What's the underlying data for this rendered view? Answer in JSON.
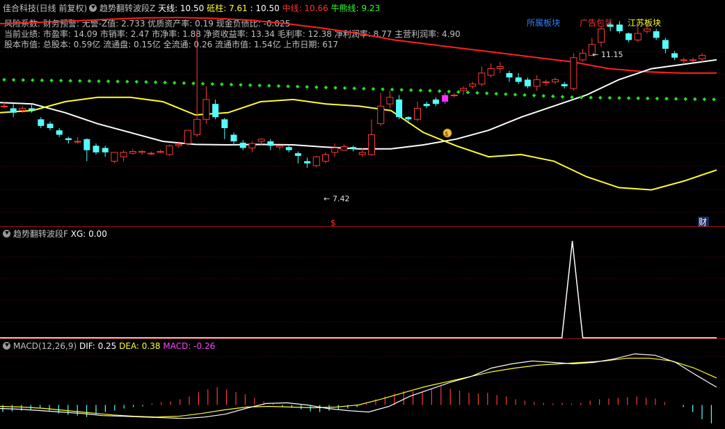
{
  "header": {
    "stock": "佳合科技(日线 前复权)",
    "ind1_name": "趋势翻转波段Z",
    "tianxian": "天线: 10.50",
    "dizhu": "砥柱: 7.61",
    "val2": ": 10.50",
    "zhongxian": "中线: 10.66",
    "niuxiong": "牛熊线: 9.23"
  },
  "info": {
    "line1": "风险系数: 财务预警: 无警-Z值: 2.733 优质资产率: 0.19 现金负债比: -0.025",
    "line2": "当前业绩: 市盈率: 14.09 市销率: 2.47 市净率: 1.88 净资收益率: 13.34 毛利率: 12.38 净利润率: 8.77 主营利润率: 4.90",
    "line3": "股本市值: 总股本: 0.59亿 流通盘: 0.15亿 全流通: 0.26 流通市值: 1.54亿 上市日期: 617"
  },
  "sectors": {
    "s1": "所属板块",
    "s2": "广告包装",
    "s3": "江苏板块"
  },
  "annotations": {
    "high": "11.15",
    "low": "7.42",
    "marker_s": "$",
    "marker_cai": "财"
  },
  "panel2": {
    "name": "趋势翻转波段F",
    "xg": "XG: 0.00"
  },
  "panel3": {
    "name": "MACD(12,26,9)",
    "dif": "DIF: 0.25",
    "dea": "DEA: 0.38",
    "macd": "MACD: -0.26"
  },
  "colors": {
    "up": "#ff3a3a",
    "down": "#54ffff",
    "midline": "#ff2020",
    "white": "#ffffff",
    "yellow": "#ffff30",
    "green_dots": "#20e020",
    "magenta": "#ff30ff"
  },
  "chart_data": [
    {
      "type": "candlestick",
      "candles": [
        [
          9.85,
          9.85,
          9.95,
          9.8
        ],
        [
          9.8,
          9.7,
          9.9,
          9.6
        ],
        [
          9.75,
          9.8,
          9.85,
          9.7
        ],
        [
          9.8,
          9.75,
          9.9,
          9.7
        ],
        [
          9.55,
          9.4,
          9.6,
          9.35
        ],
        [
          9.45,
          9.35,
          9.5,
          9.3
        ],
        [
          9.3,
          9.2,
          9.35,
          9.15
        ],
        [
          9.12,
          9.08,
          9.15,
          9.0
        ],
        [
          9.05,
          9.05,
          9.15,
          9.0
        ],
        [
          9.1,
          8.85,
          9.12,
          8.6
        ],
        [
          8.95,
          8.8,
          9.0,
          8.75
        ],
        [
          8.9,
          8.8,
          8.95,
          8.7
        ],
        [
          8.6,
          8.8,
          8.8,
          8.55
        ],
        [
          8.7,
          8.8,
          8.85,
          8.6
        ],
        [
          8.78,
          8.82,
          8.88,
          8.75
        ],
        [
          8.8,
          8.82,
          8.85,
          8.75
        ],
        [
          8.78,
          8.78,
          8.82,
          8.74
        ],
        [
          8.8,
          8.82,
          8.86,
          8.78
        ],
        [
          8.75,
          8.95,
          8.98,
          8.72
        ],
        [
          8.95,
          8.98,
          9.05,
          8.9
        ],
        [
          9.0,
          9.3,
          9.3,
          8.95
        ],
        [
          9.2,
          9.55,
          11.6,
          9.15
        ],
        [
          9.55,
          10.0,
          10.3,
          9.45
        ],
        [
          9.9,
          9.6,
          10.0,
          9.55
        ],
        [
          9.55,
          9.35,
          9.58,
          9.1
        ],
        [
          9.2,
          9.05,
          9.25,
          8.95
        ],
        [
          9.02,
          8.9,
          9.08,
          8.85
        ],
        [
          8.9,
          9.0,
          9.05,
          8.8
        ],
        [
          9.05,
          9.1,
          9.12,
          8.95
        ],
        [
          9.05,
          8.95,
          9.1,
          8.85
        ],
        [
          8.92,
          8.95,
          8.95,
          8.85
        ],
        [
          8.92,
          8.85,
          8.95,
          8.8
        ],
        [
          8.78,
          8.72,
          8.82,
          8.55
        ],
        [
          8.6,
          8.55,
          8.68,
          8.45
        ],
        [
          8.5,
          8.7,
          8.72,
          8.46
        ],
        [
          8.6,
          8.75,
          8.8,
          8.55
        ],
        [
          8.8,
          8.9,
          9.0,
          8.7
        ],
        [
          8.85,
          8.93,
          8.98,
          8.84
        ],
        [
          8.92,
          8.88,
          8.95,
          8.82
        ],
        [
          8.75,
          8.8,
          8.9,
          8.7
        ],
        [
          8.75,
          9.2,
          9.55,
          8.72
        ],
        [
          9.45,
          9.85,
          10.15,
          9.4
        ],
        [
          9.9,
          10.05,
          10.2,
          9.8
        ],
        [
          10.0,
          9.6,
          10.1,
          9.55
        ],
        [
          9.6,
          9.55,
          9.62,
          9.45
        ],
        [
          9.55,
          9.8,
          9.95,
          9.5
        ],
        [
          9.9,
          9.85,
          9.95,
          9.8
        ],
        [
          10.0,
          9.9,
          10.05,
          9.85
        ],
        [
          9.95,
          10.1,
          10.15,
          9.9
        ],
        [
          10.1,
          10.1,
          10.15,
          10.05
        ],
        [
          10.2,
          10.25,
          10.3,
          10.1
        ],
        [
          10.3,
          10.35,
          10.4,
          10.25
        ],
        [
          10.35,
          10.6,
          10.75,
          10.3
        ],
        [
          10.55,
          10.7,
          10.82,
          10.5
        ],
        [
          10.7,
          10.75,
          10.85,
          10.6
        ],
        [
          10.6,
          10.5,
          10.65,
          10.4
        ],
        [
          10.5,
          10.4,
          10.6,
          10.35
        ],
        [
          10.45,
          10.3,
          10.5,
          10.25
        ],
        [
          10.3,
          10.45,
          10.55,
          10.2
        ],
        [
          10.4,
          10.4,
          10.45,
          10.3
        ],
        [
          10.4,
          10.45,
          10.5,
          10.35
        ],
        [
          10.35,
          10.3,
          10.4,
          10.25
        ],
        [
          10.25,
          10.95,
          11.05,
          10.2
        ],
        [
          10.9,
          11.05,
          11.15,
          10.85
        ],
        [
          11.0,
          11.25,
          11.4,
          11.0
        ],
        [
          11.3,
          11.6,
          11.65,
          11.2
        ],
        [
          11.7,
          11.65,
          11.75,
          11.55
        ],
        [
          11.7,
          11.55,
          11.78,
          11.5
        ],
        [
          11.5,
          11.35,
          11.52,
          11.3
        ],
        [
          11.35,
          11.5,
          11.65,
          11.3
        ],
        [
          11.55,
          11.6,
          11.7,
          11.5
        ],
        [
          11.55,
          11.4,
          11.6,
          11.35
        ],
        [
          11.35,
          11.15,
          11.4,
          11.05
        ],
        [
          11.05,
          10.95,
          11.1,
          10.9
        ],
        [
          10.9,
          10.9,
          10.95,
          10.8
        ],
        [
          10.9,
          10.9,
          10.95,
          10.85
        ],
        [
          10.92,
          11.0,
          11.05,
          10.85
        ]
      ],
      "midline_red": [
        11.72,
        11.75,
        11.78,
        11.82,
        11.85,
        11.86,
        11.84,
        11.8,
        11.72,
        11.62,
        11.5,
        11.35,
        11.25,
        11.15,
        11.05,
        10.95,
        10.85,
        10.7,
        10.63,
        10.6,
        10.6
      ],
      "white_line": [
        9.93,
        9.9,
        9.7,
        9.45,
        9.25,
        9.05,
        8.98,
        8.97,
        8.98,
        8.97,
        8.92,
        8.88,
        8.88,
        8.97,
        9.1,
        9.3,
        9.6,
        9.85,
        10.1,
        10.45,
        10.7,
        10.8,
        10.9
      ],
      "yellow_line": [
        9.7,
        9.75,
        9.95,
        10.05,
        10.05,
        9.95,
        9.65,
        9.7,
        9.95,
        10.0,
        9.9,
        9.85,
        9.75,
        9.25,
        8.95,
        8.7,
        8.75,
        8.6,
        8.25,
        8.0,
        7.95,
        8.15,
        8.4
      ],
      "green_dots_level": [
        10.45,
        10.4,
        10.3,
        10.2,
        10.05,
        10.0
      ],
      "ylim": [
        7.2,
        12.1
      ]
    },
    {
      "type": "line",
      "name": "XG",
      "values_peak": 1,
      "peak_index": 63
    },
    {
      "type": "bar",
      "name": "MACD",
      "values": [
        -0.1,
        -0.09,
        -0.08,
        -0.07,
        -0.05,
        -0.08,
        -0.12,
        -0.14,
        -0.15,
        -0.17,
        -0.13,
        -0.1,
        -0.08,
        -0.05,
        -0.03,
        -0.02,
        0.02,
        0.04,
        0.05,
        0.08,
        0.12,
        0.18,
        0.22,
        0.25,
        0.22,
        0.18,
        0.15,
        0.1,
        0.05,
        0.02,
        -0.02,
        -0.04,
        -0.06,
        -0.09,
        -0.1,
        -0.08,
        -0.06,
        -0.05,
        -0.03,
        0.02,
        0.08,
        0.12,
        0.16,
        0.2,
        0.19,
        0.18,
        0.22,
        0.26,
        0.23,
        0.2,
        0.17,
        0.16,
        0.17,
        0.14,
        0.12,
        0.08,
        0.06,
        0.04,
        0.03,
        0.02,
        0.03,
        0.02,
        0.03,
        0.06,
        0.08,
        0.09,
        0.1,
        0.11,
        0.12,
        0.1,
        0.09,
        0.04,
        0.0,
        -0.03,
        -0.1,
        -0.2,
        -0.26
      ],
      "dif": [
        -0.05,
        -0.06,
        -0.08,
        -0.1,
        -0.12,
        -0.15,
        -0.16,
        -0.17,
        -0.18,
        -0.19,
        -0.17,
        -0.13,
        -0.05,
        0.02,
        0.03,
        0.0,
        -0.05,
        -0.08,
        -0.1,
        -0.02,
        0.12,
        0.22,
        0.32,
        0.4,
        0.52,
        0.58,
        0.62,
        0.6,
        0.58,
        0.6,
        0.65,
        0.72,
        0.7,
        0.6,
        0.42,
        0.25
      ],
      "dea": [
        -0.02,
        -0.03,
        -0.05,
        -0.08,
        -0.11,
        -0.14,
        -0.16,
        -0.17,
        -0.16,
        -0.12,
        -0.07,
        -0.03,
        -0.02,
        -0.03,
        -0.04,
        -0.03,
        0.0,
        0.08,
        0.17,
        0.26,
        0.33,
        0.4,
        0.47,
        0.52,
        0.56,
        0.58,
        0.6,
        0.62,
        0.66,
        0.66,
        0.62,
        0.52,
        0.38
      ],
      "ylim": [
        -0.3,
        0.8
      ]
    }
  ]
}
